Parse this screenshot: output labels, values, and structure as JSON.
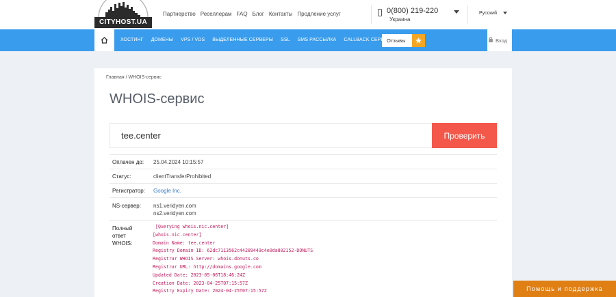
{
  "logo": {
    "text": "CITYHOST.UA"
  },
  "top_links": [
    "Партнерство",
    "Реселлерам",
    "FAQ",
    "Блог",
    "Контакты",
    "Продление услуг"
  ],
  "phone": {
    "number": "0(800) 219-220",
    "country": "Украина"
  },
  "language": "Русский",
  "nav": {
    "items": [
      "ХОСТИНГ",
      "ДОМЕНЫ",
      "VPS / VDS",
      "ВЫДЕЛЕННЫЕ СЕРВЕРЫ",
      "SSL",
      "SMS РАССЫЛКА",
      "CALLBACK СЕРВИС"
    ],
    "reviews_label": "Отзывы",
    "login_label": "Вход"
  },
  "breadcrumb": "Главная / WHOIS-сервис",
  "page_title": "WHOIS-сервис",
  "search": {
    "value": "tee.center",
    "button_label": "Проверить"
  },
  "details": {
    "paid_until": {
      "label": "Оплачен до:",
      "value": "25.04.2024 10:15:57"
    },
    "status": {
      "label": "Статус:",
      "value": "clientTransferProhibited"
    },
    "registrar": {
      "label": "Регистратор:",
      "value": "Google Inc."
    },
    "ns": {
      "label": "NS-сервер:",
      "values": [
        "ns1.veridyen.com",
        "ns2.veridyen.com"
      ]
    },
    "whois": {
      "label": "Полный\nответ\nWHOIS:",
      "raw": " [Querying whois.nic.center]\n[whois.nic.center]\nDomain Name: tee.center\nRegistry Domain ID: 62dc7113562c44289449c4e0da802152-DONUTS\nRegistrar WHOIS Server: whois.donuts.co\nRegistrar URL: http://domains.google.com\nUpdated Date: 2023-05-06T18:46:24Z\nCreation Date: 2023-04-25T07:15:57Z\nRegistry Expiry Date: 2024-04-25T07:15:57Z"
    }
  },
  "help_button": "Помощь и поддержка",
  "colors": {
    "nav_blue": "#3a9cec",
    "check_red": "#f4584b",
    "help_orange": "#e07f14",
    "star_orange": "#f5a623"
  }
}
